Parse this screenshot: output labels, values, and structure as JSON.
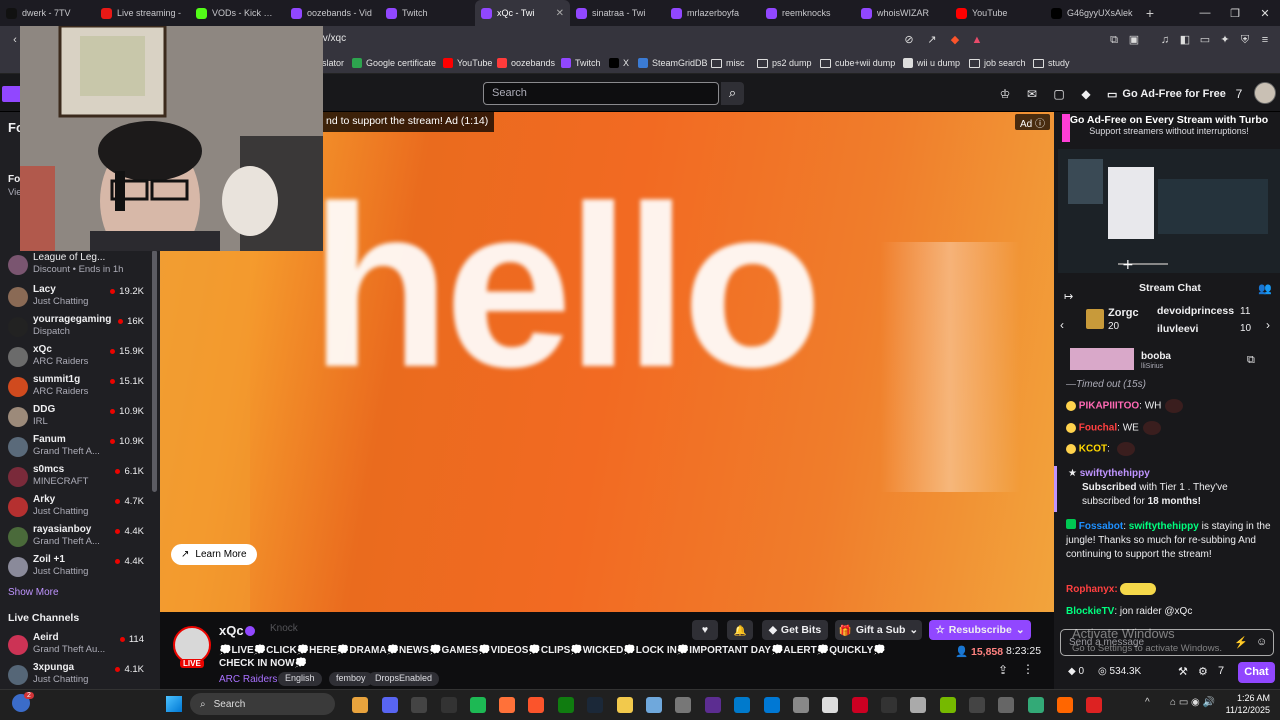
{
  "browser": {
    "tabs": [
      {
        "label": "dwerk - 7TV",
        "color": "#111111"
      },
      {
        "label": "Live streaming - ",
        "color": "#e91916"
      },
      {
        "label": "VODs - Kick Dash",
        "color": "#53fc18"
      },
      {
        "label": "oozebands - Vid",
        "color": "#9147ff"
      },
      {
        "label": "Twitch",
        "color": "#9147ff"
      },
      {
        "label": "xQc - Twi",
        "color": "#9147ff",
        "active": true
      },
      {
        "label": "sinatraa - Twi",
        "color": "#9147ff"
      },
      {
        "label": "mrlazerboyfa",
        "color": "#9147ff"
      },
      {
        "label": "reemknocks",
        "color": "#9147ff"
      },
      {
        "label": "whoisWIZAR",
        "color": "#9147ff"
      },
      {
        "label": "YouTube",
        "color": "#ff0000"
      },
      {
        "label": "G46gyyUXsAlek",
        "color": "#000000"
      }
    ],
    "url": "tv/xqc",
    "bookmarks": [
      {
        "label": "slator",
        "kind": "text"
      },
      {
        "label": "Google certificate",
        "kind": "site",
        "color": "#2da44e"
      },
      {
        "label": "YouTube",
        "kind": "site",
        "color": "#ff0000"
      },
      {
        "label": "oozebands",
        "kind": "site",
        "color": "#ff3b3b"
      },
      {
        "label": "Twitch",
        "kind": "site",
        "color": "#9147ff"
      },
      {
        "label": "X",
        "kind": "site",
        "color": "#000000"
      },
      {
        "label": "SteamGridDB",
        "kind": "site",
        "color": "#3b7bd4"
      },
      {
        "label": "misc",
        "kind": "folder"
      },
      {
        "label": "ps2 dump",
        "kind": "folder"
      },
      {
        "label": "cube+wii dump",
        "kind": "folder"
      },
      {
        "label": "wii u dump",
        "kind": "site",
        "color": "#dddddd"
      },
      {
        "label": "job search",
        "kind": "folder"
      },
      {
        "label": "study",
        "kind": "folder"
      }
    ]
  },
  "twitch_nav": {
    "search_placeholder": "Search",
    "adfree_label": "Go Ad-Free for Free"
  },
  "sidebar": {
    "partial_title": "Fo",
    "partial_section": "Fol",
    "partial_sub": "Vie",
    "discount_game": "League of Leg...",
    "discount_text": "Discount • Ends in 1h",
    "channels": [
      {
        "name": "Lacy",
        "game": "Just Chatting",
        "viewers": "19.2K",
        "color": "#8a6a55"
      },
      {
        "name": "yourragegaming",
        "game": "Dispatch",
        "viewers": "16K",
        "color": "#222222"
      },
      {
        "name": "xQc",
        "game": "ARC Raiders",
        "viewers": "15.9K",
        "color": "#6b6b6b"
      },
      {
        "name": "summit1g",
        "game": "ARC Raiders",
        "viewers": "15.1K",
        "color": "#d04a1e"
      },
      {
        "name": "DDG",
        "game": "IRL",
        "viewers": "10.9K",
        "color": "#9c8a7a"
      },
      {
        "name": "Fanum",
        "game": "Grand Theft A...",
        "viewers": "10.9K",
        "color": "#5a6a7a"
      },
      {
        "name": "s0mcs",
        "game": "MINECRAFT",
        "viewers": "6.1K",
        "color": "#7a2a3a"
      },
      {
        "name": "Arky",
        "game": "Just Chatting",
        "viewers": "4.7K",
        "color": "#b53030"
      },
      {
        "name": "rayasianboy",
        "game": "Grand Theft A...",
        "viewers": "4.4K",
        "color": "#4a6a3a"
      },
      {
        "name": "Zoil +1",
        "game": "Just Chatting",
        "viewers": "4.4K",
        "color": "#8a8a9a"
      }
    ],
    "show_more": "Show More",
    "live_channels_header": "Live Channels",
    "live_channels": [
      {
        "name": "Aeird",
        "game": "Grand Theft Au...",
        "viewers": "114",
        "color": "#cc3355"
      },
      {
        "name": "3xpunga",
        "game": "Just Chatting",
        "viewers": "4.1K",
        "color": "#556677"
      }
    ]
  },
  "player": {
    "ad_banner": "nd to support the stream! Ad (1:14)",
    "ad_tag": "Ad",
    "video_text": "hello",
    "learn_more": "Learn More"
  },
  "stream_info": {
    "streamer": "xQc",
    "live_badge": "LIVE",
    "knock": "Knock",
    "title": "💭LIVE💭CLICK💭HERE💭DRAMA💭NEWS💭GAMES💭VIDEOS💭CLIPS💭WICKED💭LOCK IN💭IMPORTANT DAY💭ALERT💭QUICKLY💭CHECK IN NOW💭",
    "category": "ARC Raiders",
    "tags": [
      "English",
      "femboy",
      "DropsEnabled"
    ],
    "get_bits": "Get Bits",
    "gift_sub": "Gift a Sub",
    "resubscribe": "Resubscribe",
    "viewers": "15,858",
    "uptime": "8:23:25"
  },
  "chat": {
    "turbo_title": "Go Ad-Free on Every Stream with Turbo",
    "turbo_sub": "Support streamers without interruptions!",
    "header": "Stream Chat",
    "leaderboard": [
      {
        "name": "Zorgc",
        "value": "20"
      },
      {
        "name": "devoidprincess",
        "value": "11"
      },
      {
        "name": "iluvleevi",
        "value": "10"
      }
    ],
    "pinned_name": "booba",
    "pinned_sub": "lliSirius",
    "timed_out": "—Timed out (15s)",
    "messages": [
      {
        "user": "PIKAPIIITOO",
        "color": "#ff69b4",
        "text": "WH"
      },
      {
        "user": "Fouchal",
        "color": "#ff4040",
        "text": "WE"
      },
      {
        "user": "KCOT",
        "color": "#ffd700",
        "text": ""
      }
    ],
    "sub_user": "swiftythehippy",
    "sub_line1": "Subscribed",
    "sub_line2": "with Tier 1 . They've subscribed for",
    "sub_months": "18 months!",
    "bot_user": "Fossabot",
    "bot_mention": "swiftythehippy",
    "bot_text1": "is staying in the jungle!",
    "bot_text2": "Thanks so much for re-subbing",
    "bot_text3": "And continuing to support the stream!",
    "msg_rophanyx": "Rophanyx:",
    "blockie_user": "BlockieTV",
    "blockie_text": "jon raider @xQc",
    "input_placeholder": "Send a message",
    "activate_1": "Activate Windows",
    "activate_2": "Go to Settings to activate Windows.",
    "bits": "0",
    "points": "534.3K",
    "chat_button": "Chat"
  },
  "taskbar": {
    "search": "Search",
    "time": "1:26 AM",
    "date": "11/12/2025",
    "badge": "2"
  }
}
